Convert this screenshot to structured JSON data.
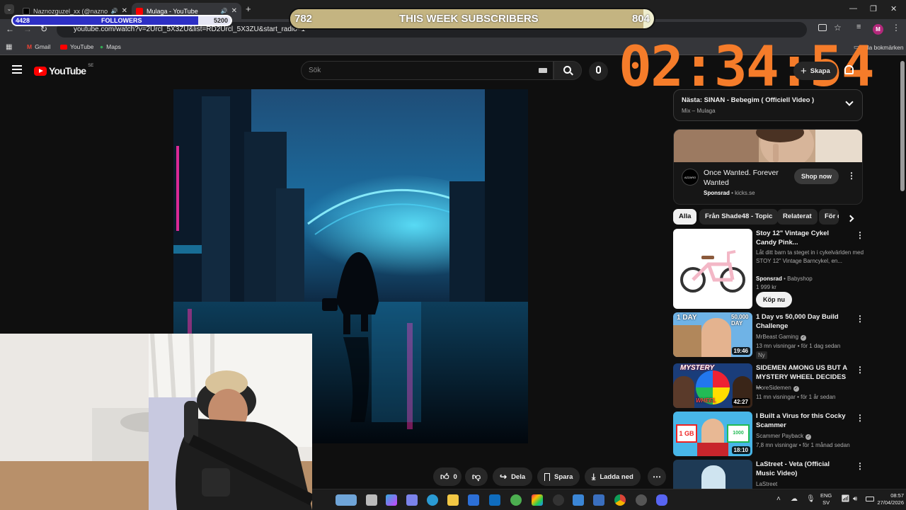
{
  "browser": {
    "tabs": [
      {
        "title": "Naznozguzel_xx (@naznoz...",
        "active": false
      },
      {
        "title": "Mulaga - YouTube",
        "active": true
      }
    ],
    "url": "youtube.com/watch?v=2Urcl_5X3ZU&list=RD2Urcl_5X3ZU&start_radio=1",
    "bookmarks": [
      "Gmail",
      "YouTube",
      "Maps"
    ],
    "bookmarks_right": "Alla bokmärken",
    "profile_initial": "M"
  },
  "overlay": {
    "followers": {
      "current": "4428",
      "label": "FOLLOWERS",
      "goal": "5200",
      "progress": 0.85
    },
    "subscribers": {
      "start": "782",
      "label": "THIS WEEK SUBSCRIBERS",
      "goal": "804",
      "progress": 0.97
    },
    "countdown": "02:34:54"
  },
  "youtube": {
    "logo": "YouTube",
    "region": "SE",
    "search_placeholder": "Sök",
    "create_label": "Skapa",
    "actions": {
      "likes": "0",
      "share": "Dela",
      "save": "Spara",
      "download": "Ladda ned"
    }
  },
  "sidebar": {
    "next": {
      "title": "Nästa: SINAN - Bebegim ( Officiell Video )",
      "sub": "Mix – Mulaga"
    },
    "ad": {
      "brand": "AZZARO",
      "title": "Once Wanted. Forever Wanted",
      "sponsor": "Sponsrad",
      "domain": "kicks.se",
      "cta": "Shop now"
    },
    "chips": [
      "Alla",
      "Från Shade48 - Topic",
      "Relaterat",
      "För dig"
    ],
    "recs": [
      {
        "title": "Stoy 12\" Vintage Cykel Candy Pink...",
        "desc": "Låt ditt barn ta steget in i cykelvärlden med STOY 12\" Vintage Barncykel, en...",
        "sponsor": "Sponsrad",
        "channel": "Babyshop",
        "price": "1 999 kr",
        "cta": "Köp nu"
      },
      {
        "title": "1 Day vs 50,000 Day Build Challenge",
        "channel": "MrBeast Gaming",
        "meta": "13 mn visningar • för 1 dag sedan",
        "badge": "Ny",
        "duration": "19:46",
        "thumb_top": "1 DAY",
        "thumb_right": "50,000 DAY"
      },
      {
        "title": "SIDEMEN AMONG US BUT A MYSTERY WHEEL DECIDES ...",
        "channel": "MoreSidemen",
        "meta": "11 mn visningar • för 1 år sedan",
        "duration": "42:27",
        "thumb_top": "MYSTERY",
        "thumb_bottom": "WHEEL"
      },
      {
        "title": "I Built a Virus for this Cocky Scammer",
        "channel": "Scammer Payback",
        "meta": "7,8 mn visningar • för 1 månad sedan",
        "duration": "18:10",
        "thumb_left": "1 GB",
        "thumb_right": "1000 GB"
      },
      {
        "title": "LaStreet - Veta (Official Music Video)",
        "channel": "LaStreet",
        "meta": ""
      }
    ]
  },
  "taskbar": {
    "lang": "ENG",
    "region": "SV",
    "time": "08:57",
    "date": "27/04/2026"
  },
  "colors": {
    "countdown": "#f57c2a",
    "followers_fill": "#2d2fc5",
    "subs_fill": "#c4b481",
    "youtube_red": "#ff0000"
  }
}
